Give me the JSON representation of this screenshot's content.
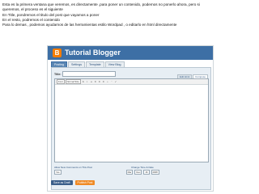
{
  "caption": {
    "lines": [
      "Esta es la primera ventana que veremos, es directamente ,para poner un contenido, podemos no ponerlo ahora, pero si",
      "queremos, el proceso es el siguiente",
      "En Title, pondremos el titulo del post que vayamos a poner",
      "En el resto, podremos el contenido",
      "Para lo demas , podemos ayudarnos de las herramientas estilo Wordpad , o editarlo en html directamente"
    ]
  },
  "blogger": {
    "logo_letter": "B",
    "title": "Tutorial Blogger",
    "tabs": [
      "Posting",
      "Settings",
      "Template",
      "View Blog"
    ],
    "title_label": "Title:",
    "title_value": "",
    "mode_tabs": [
      "Edit Html",
      "Compose"
    ],
    "font_select": "Font",
    "size_select": "Normal Size",
    "tool_glyphs": [
      "b",
      "i",
      "u",
      "≡",
      "≡",
      "≡",
      "•",
      "“",
      "✓"
    ],
    "options_left": "Allow New Comments on This Post",
    "options_right": "Change Time & Date",
    "comment_value": "Yes",
    "date_values": [
      "Mar",
      "Dec",
      "16",
      "2008"
    ],
    "buttons": {
      "draft": "Save as Draft",
      "publish": "Publish Post"
    }
  },
  "colors": {
    "header": "#3d6fa5",
    "publish": "#f08a24",
    "draft": "#3b5f8a"
  }
}
